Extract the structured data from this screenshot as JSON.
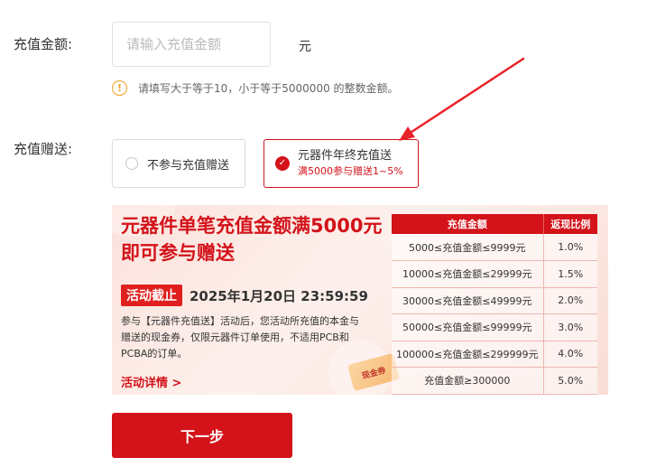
{
  "amount": {
    "label": "充值金额:",
    "placeholder": "请输入充值金额",
    "value": "",
    "unit": "元",
    "hint": "请填写大于等于10，小于等于5000000 的整数金额。",
    "hint_icon": "warning-circle-icon"
  },
  "gift": {
    "label": "充值赠送:",
    "options": [
      {
        "label": "不参与充值赠送",
        "selected": false
      },
      {
        "label": "元器件年终充值送",
        "sub": "满5000参与赠送1~5%",
        "selected": true
      }
    ]
  },
  "banner": {
    "title_line1": "元器件单笔充值金额满5000元",
    "title_line2": "即可参与赠送",
    "deadline_label": "活动截止",
    "deadline_date": "2025年1月20日 23:59:59",
    "description": "参与【元器件充值送】活动后，您活动所充值的本金与赠送的现金券，仅限元器件订单使用，不适用PCB和PCBA的订单。",
    "link": "活动详情 >",
    "coupon_text": "现金券",
    "table": {
      "headers": [
        "充值金额",
        "返现比例"
      ],
      "rows": [
        [
          "5000≤充值金额≤9999元",
          "1.0%"
        ],
        [
          "10000≤充值金额≤29999元",
          "1.5%"
        ],
        [
          "30000≤充值金额≤49999元",
          "2.0%"
        ],
        [
          "50000≤充值金额≤99999元",
          "3.0%"
        ],
        [
          "100000≤充值金额≤299999元",
          "4.0%"
        ],
        [
          "充值金额≥300000",
          "5.0%"
        ]
      ]
    }
  },
  "next_button": "下一步",
  "colors": {
    "accent": "#d3121a",
    "warning": "#f0a020"
  }
}
